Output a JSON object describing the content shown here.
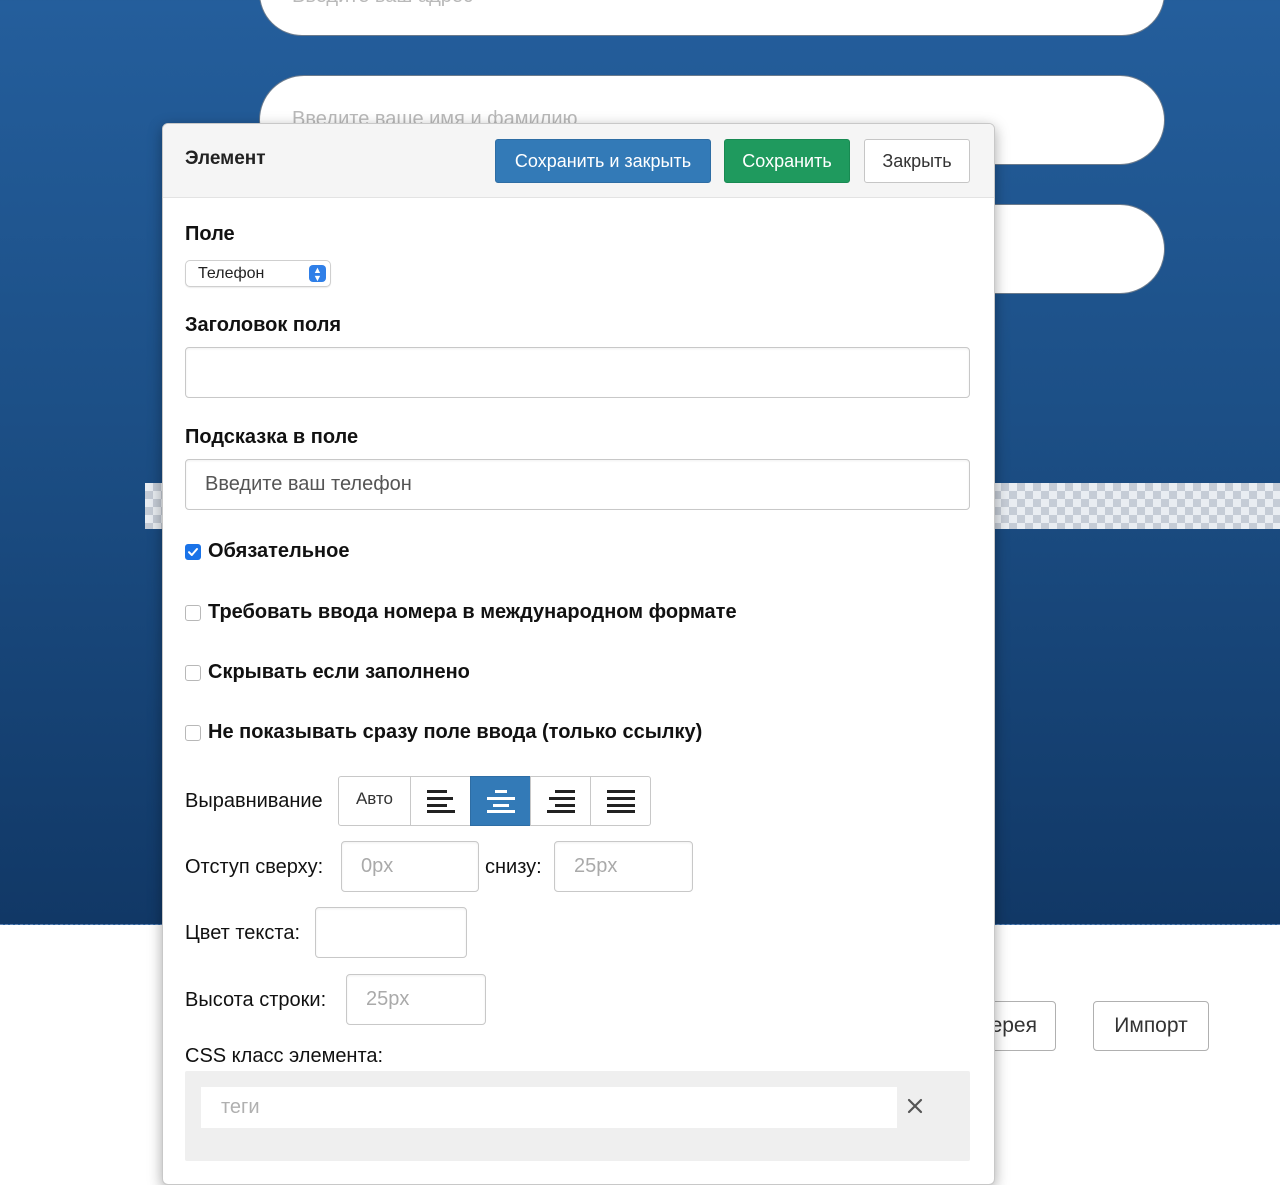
{
  "background": {
    "pill_top_placeholder": "Введите ваш адрес",
    "pill_name_placeholder": "Введите ваше имя и фамилию",
    "gallery_button": "ерея",
    "import_button": "Импорт"
  },
  "modal": {
    "title": "Элемент",
    "buttons": {
      "save_close": "Сохранить и закрыть",
      "save": "Сохранить",
      "close": "Закрыть"
    },
    "field": {
      "label": "Поле",
      "selected": "Телефон"
    },
    "field_title": {
      "label": "Заголовок поля",
      "value": ""
    },
    "hint": {
      "label": "Подсказка в поле",
      "value": "Введите ваш телефон"
    },
    "checkboxes": [
      {
        "label": "Обязательное",
        "checked": true
      },
      {
        "label": "Требовать ввода номера в международном формате",
        "checked": false
      },
      {
        "label": "Скрывать если заполнено",
        "checked": false
      },
      {
        "label": "Не показывать сразу поле ввода (только ссылку)",
        "checked": false
      }
    ],
    "alignment": {
      "label": "Выравнивание",
      "auto": "Авто",
      "options": [
        "align-left-icon",
        "align-center-icon",
        "align-right-icon",
        "align-justify-icon"
      ],
      "active": "align-center-icon"
    },
    "margin": {
      "top_label": "Отступ сверху:",
      "top_placeholder": "0px",
      "bottom_label": "снизу:",
      "bottom_placeholder": "25px"
    },
    "text_color": {
      "label": "Цвет текста:",
      "value": ""
    },
    "line_height": {
      "label": "Высота строки:",
      "placeholder": "25px"
    },
    "css_class": {
      "label": "CSS класс элемента:",
      "placeholder": "теги"
    }
  },
  "colors": {
    "primary": "#337ab7",
    "success": "#1f9a5e",
    "background_blue": "#1c4f86",
    "checkbox_checked": "#1a73e8"
  }
}
